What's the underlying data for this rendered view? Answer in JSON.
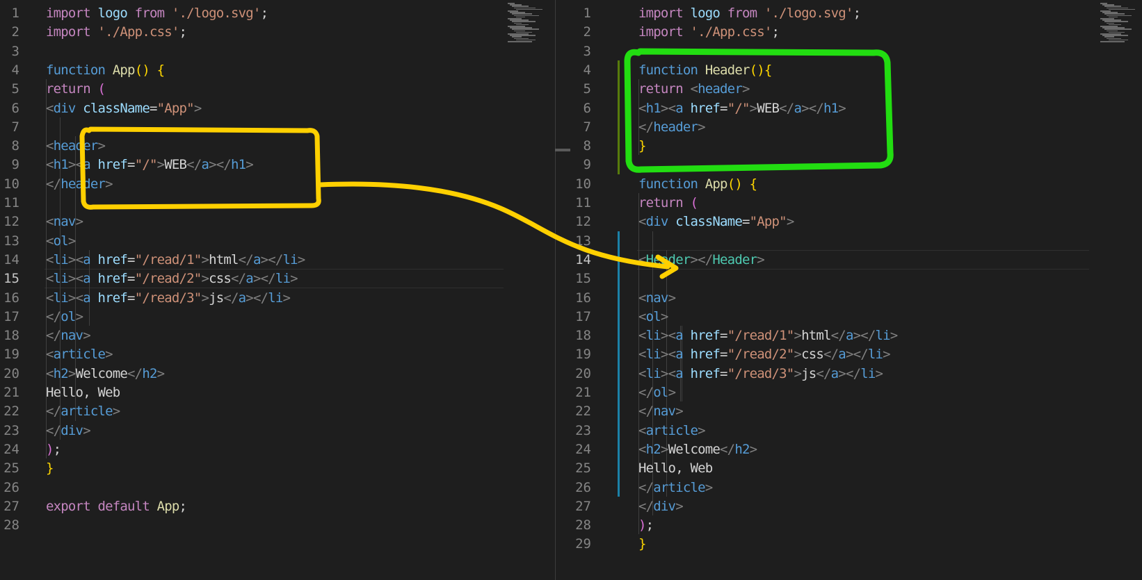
{
  "left_editor": {
    "active_line": "15",
    "lines": [
      {
        "n": "1",
        "t": "import logo from './logo.svg';"
      },
      {
        "n": "2",
        "t": "import './App.css';"
      },
      {
        "n": "3",
        "t": ""
      },
      {
        "n": "4",
        "t": "function App() {"
      },
      {
        "n": "5",
        "t": "  return ("
      },
      {
        "n": "6",
        "t": "    <div className=\"App\">"
      },
      {
        "n": "7",
        "t": ""
      },
      {
        "n": "8",
        "t": "      <header>"
      },
      {
        "n": "9",
        "t": "        <h1><a href=\"/\">WEB</a></h1>"
      },
      {
        "n": "10",
        "t": "      </header>"
      },
      {
        "n": "11",
        "t": ""
      },
      {
        "n": "12",
        "t": "      <nav>"
      },
      {
        "n": "13",
        "t": "        <ol>"
      },
      {
        "n": "14",
        "t": "          <li><a href=\"/read/1\">html</a></li>"
      },
      {
        "n": "15",
        "t": "          <li><a href=\"/read/2\">css</a></li>"
      },
      {
        "n": "16",
        "t": "          <li><a href=\"/read/3\">js</a></li>"
      },
      {
        "n": "17",
        "t": "        </ol>"
      },
      {
        "n": "18",
        "t": "      </nav>"
      },
      {
        "n": "19",
        "t": "      <article>"
      },
      {
        "n": "20",
        "t": "        <h2>Welcome</h2>"
      },
      {
        "n": "21",
        "t": "        Hello, Web"
      },
      {
        "n": "22",
        "t": "      </article>"
      },
      {
        "n": "23",
        "t": "    </div>"
      },
      {
        "n": "24",
        "t": "  );"
      },
      {
        "n": "25",
        "t": "}"
      },
      {
        "n": "26",
        "t": ""
      },
      {
        "n": "27",
        "t": "export default App;"
      },
      {
        "n": "28",
        "t": ""
      }
    ]
  },
  "right_editor": {
    "active_line": "14",
    "lines": [
      {
        "n": "1",
        "t": "import logo from './logo.svg';"
      },
      {
        "n": "2",
        "t": "import './App.css';"
      },
      {
        "n": "3",
        "t": ""
      },
      {
        "n": "4",
        "t": "function Header(){"
      },
      {
        "n": "5",
        "t": "  return <header>"
      },
      {
        "n": "6",
        "t": "    <h1><a href=\"/\">WEB</a></h1>"
      },
      {
        "n": "7",
        "t": "  </header>"
      },
      {
        "n": "8",
        "t": "}"
      },
      {
        "n": "9",
        "t": ""
      },
      {
        "n": "10",
        "t": "function App() {"
      },
      {
        "n": "11",
        "t": "  return ("
      },
      {
        "n": "12",
        "t": "    <div className=\"App\">"
      },
      {
        "n": "13",
        "t": ""
      },
      {
        "n": "14",
        "t": "      <Header></Header>"
      },
      {
        "n": "15",
        "t": ""
      },
      {
        "n": "16",
        "t": "      <nav>"
      },
      {
        "n": "17",
        "t": "        <ol>"
      },
      {
        "n": "18",
        "t": "          <li><a href=\"/read/1\">html</a></li>"
      },
      {
        "n": "19",
        "t": "          <li><a href=\"/read/2\">css</a></li>"
      },
      {
        "n": "20",
        "t": "          <li><a href=\"/read/3\">js</a></li>"
      },
      {
        "n": "21",
        "t": "        </ol>"
      },
      {
        "n": "22",
        "t": "      </nav>"
      },
      {
        "n": "23",
        "t": "      <article>"
      },
      {
        "n": "24",
        "t": "        <h2>Welcome</h2>"
      },
      {
        "n": "25",
        "t": "        Hello, Web"
      },
      {
        "n": "26",
        "t": "      </article>"
      },
      {
        "n": "27",
        "t": "    </div>"
      },
      {
        "n": "28",
        "t": "  );"
      },
      {
        "n": "29",
        "t": "}"
      }
    ]
  },
  "annotations": {
    "yellow_box_color": "#ffd000",
    "green_box_color": "#22dd11",
    "arrow_color": "#ffd000",
    "arrow_from": "left header block",
    "arrow_to": "<Header></Header>"
  }
}
